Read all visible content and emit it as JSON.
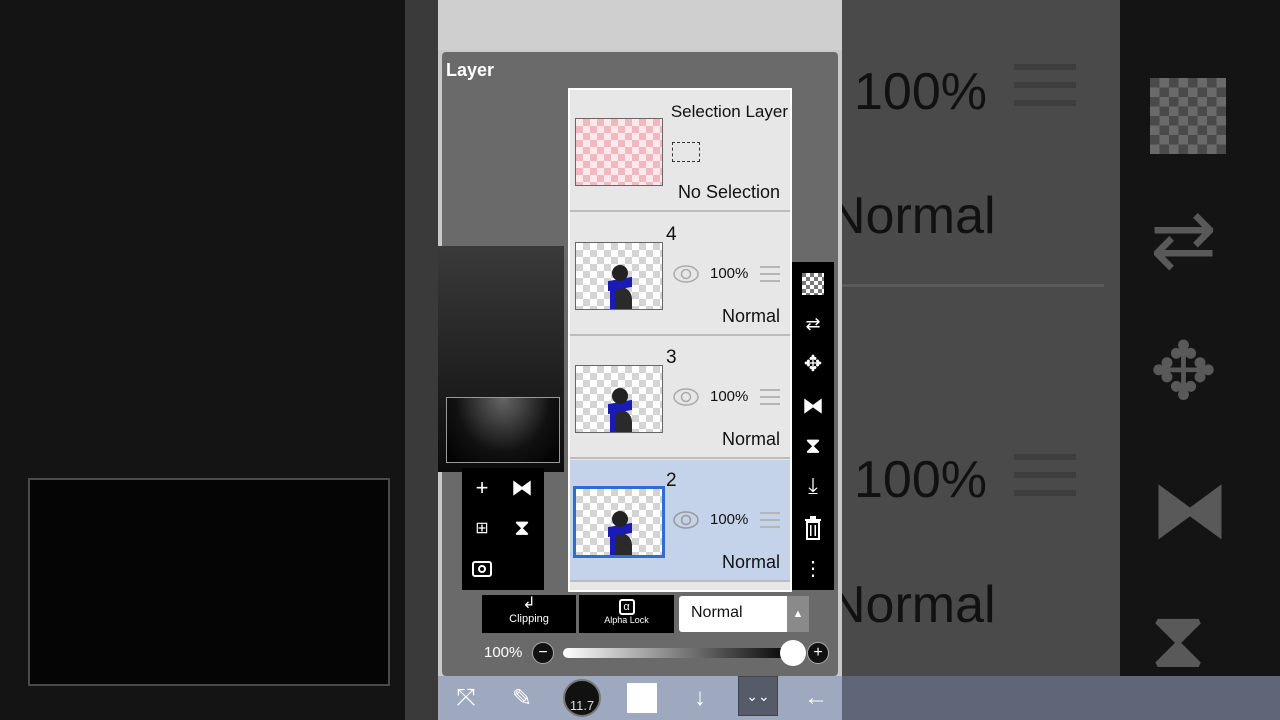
{
  "panel": {
    "title": "Layer"
  },
  "selection_layer": {
    "name": "Selection Layer",
    "status": "No Selection"
  },
  "layers": [
    {
      "number": "4",
      "opacity": "100%",
      "blend": "Normal",
      "selected": false
    },
    {
      "number": "3",
      "opacity": "100%",
      "blend": "Normal",
      "selected": false
    },
    {
      "number": "2",
      "opacity": "100%",
      "blend": "Normal",
      "selected": true
    }
  ],
  "left_tools": [
    "add-layer-icon",
    "flip-horizontal-icon",
    "add-layer-copy-icon",
    "flip-vertical-icon",
    "camera-icon"
  ],
  "right_strip": [
    "transparency-checker-icon",
    "swap-layers-icon",
    "move-icon",
    "flip-horizontal-icon",
    "flip-vertical-icon",
    "merge-down-icon",
    "trash-icon",
    "more-icon"
  ],
  "controls": {
    "clipping_label": "Clipping",
    "alpha_lock_label": "Alpha Lock",
    "alpha_symbol": "α",
    "blend_mode": "Normal",
    "opacity_label": "100%",
    "opacity_value": 1.0
  },
  "toolbar": {
    "brush_size": "11.7",
    "items": [
      "transform-icon",
      "brush-icon",
      "brush-size",
      "color-swatch",
      "down-arrow-icon",
      "layer-icon",
      "back-icon"
    ]
  },
  "background": {
    "zoom_opacity_1": "100%",
    "zoom_blend_1": "Normal",
    "zoom_opacity_2": "100%",
    "zoom_blend_2": "Normal"
  }
}
